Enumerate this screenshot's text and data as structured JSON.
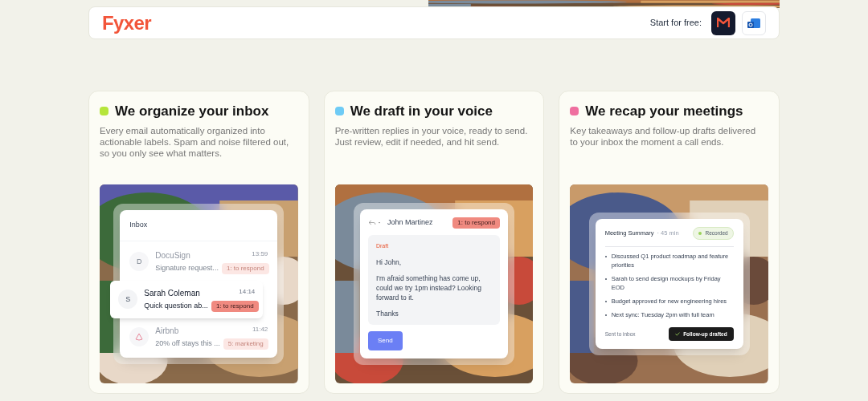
{
  "header": {
    "logo": "Fyxer",
    "cta_label": "Start for free:"
  },
  "features": [
    {
      "kind": "inbox",
      "title": "We organize your inbox",
      "color": "#b5e53b",
      "description": "Every email automatically organized into actionable labels. Spam and noise filtered out, so you only see what matters.",
      "panel": {
        "title": "Inbox",
        "emails": [
          {
            "avatar": "D",
            "sender": "DocuSign",
            "time": "13:59",
            "preview": "Signature request...",
            "label": "1: to respond",
            "highlighted": false
          },
          {
            "avatar": "S",
            "sender": "Sarah Coleman",
            "time": "14:14",
            "preview": "Quick question ab...",
            "label": "1: to respond",
            "highlighted": true
          },
          {
            "sender": "Airbnb",
            "time": "11:42",
            "preview": "20% off stays this ...",
            "label": "5: marketing",
            "highlighted": false
          }
        ]
      }
    },
    {
      "kind": "draft",
      "title": "We draft in your voice",
      "color": "#6ecbf5",
      "description": "Pre-written replies in your voice, ready to send. Just review, edit if needed, and hit send.",
      "panel": {
        "recipient": "John Martinez",
        "label": "1: to respond",
        "draft_label": "Draft",
        "greeting": "Hi John,",
        "body": "I'm afraid something has come up, could we try 1pm instead? Looking forward to it.",
        "signoff": "Thanks",
        "send": "Send"
      }
    },
    {
      "kind": "meeting",
      "title": "We recap your meetings",
      "color": "#ef6f9f",
      "description": "Key takeaways and follow-up drafts delivered to your inbox the moment a call ends.",
      "panel": {
        "title": "Meeting Summary",
        "duration": "· 45 min",
        "status": "Recorded",
        "bullets": [
          "Discussed Q1 product roadmap and feature priorities",
          "Sarah to send design mockups by Friday EOD",
          "Budget approved for new engineering hires",
          "Next sync: Tuesday 2pm with full team"
        ],
        "footer": "Sent to inbox",
        "badge": "Follow-up drafted"
      }
    }
  ]
}
